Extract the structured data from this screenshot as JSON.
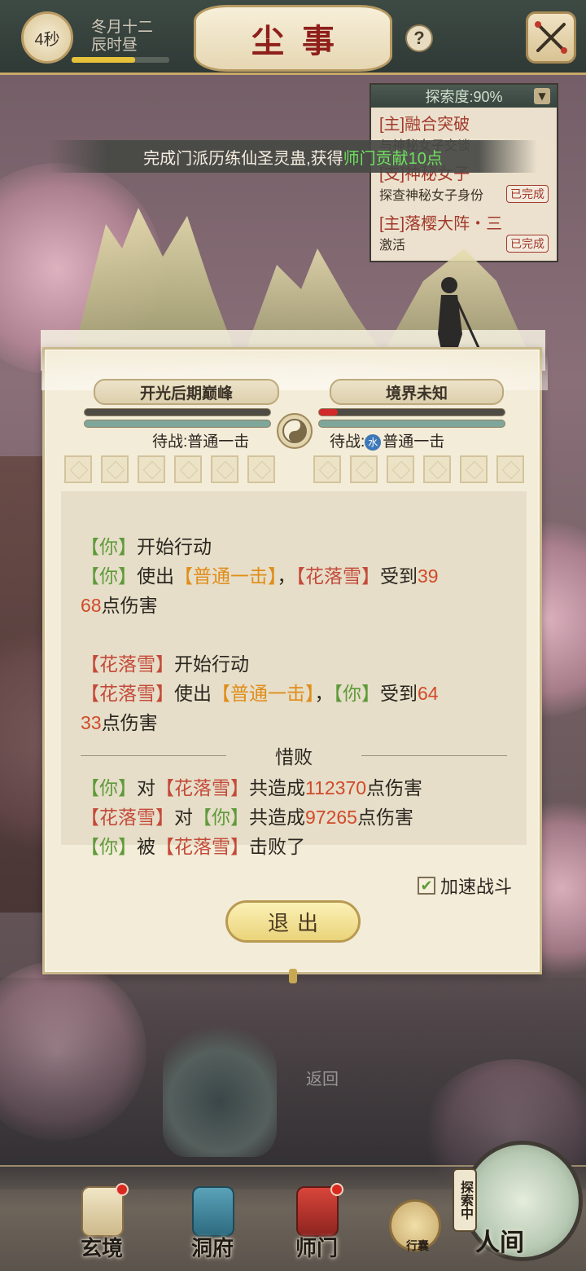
{
  "top_bar": {
    "timer": "4秒",
    "date_line1": "冬月十二",
    "date_line2": "辰时昼",
    "time_progress": 0.65,
    "title": "尘事",
    "help_label": "?"
  },
  "quest_panel": {
    "header": "探索度:90%",
    "quests": [
      {
        "title": "[主]融合突破",
        "sub": "与神秘女子交谈",
        "status": ""
      },
      {
        "title": "[支]神秘女子",
        "sub": "探查神秘女子身份",
        "status": "已完成"
      },
      {
        "title": "[主]落樱大阵・三",
        "sub": "激活",
        "status": "已完成"
      }
    ]
  },
  "notice": {
    "text": "完成门派历练仙圣灵蛊,获得",
    "highlight": "师门贡献10点"
  },
  "battle": {
    "player_realm": "开光后期巅峰",
    "enemy_realm": "境界未知",
    "player_hp": 1.0,
    "enemy_hp": 0.1,
    "player_status": "待战:普通一击",
    "enemy_status_prefix": "待战:",
    "enemy_element": "水",
    "enemy_status_skill": "普通一击",
    "log": {
      "you": "【你】",
      "enemy": "【花落雪】",
      "skill": "【普通一击】",
      "start_action": "开始行动",
      "use": "使出",
      "comma": "，",
      "receive": "受到",
      "damage_suffix": "点伤害",
      "dmg1_a": "39",
      "dmg1_b": "68",
      "dmg2_a": "64",
      "dmg2_b": "33",
      "result_title": "惜败",
      "to": "对",
      "total": "共造成",
      "you_total": "112370",
      "enemy_total": "97265",
      "by": "被",
      "defeated": "击败了"
    },
    "speed_label": "加速战斗",
    "speed_checked": true,
    "exit_label": "退出"
  },
  "background": {
    "return_text": "返回"
  },
  "bottom_nav": {
    "items": [
      "玄境",
      "洞府",
      "师门"
    ],
    "bag": "行囊",
    "explore_tag": "探索中",
    "human": "人间"
  }
}
